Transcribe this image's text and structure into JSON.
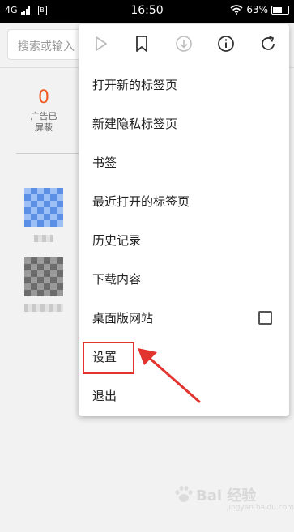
{
  "status_bar": {
    "network": "4G",
    "sim_label": "B",
    "time": "16:50",
    "battery": "63%",
    "battery_level": 0.63
  },
  "search": {
    "placeholder_visible": "搜索或输入"
  },
  "stats": {
    "blocked_count": "0",
    "blocked_label": "广告已屏蔽"
  },
  "menu": {
    "toolbar_icons": [
      "forward-icon",
      "bookmark-add-icon",
      "download-icon",
      "info-icon",
      "refresh-icon"
    ],
    "items": [
      {
        "label": "打开新的标签页"
      },
      {
        "label": "新建隐私标签页"
      },
      {
        "label": "书签"
      },
      {
        "label": "最近打开的标签页"
      },
      {
        "label": "历史记录"
      },
      {
        "label": "下载内容"
      },
      {
        "label": "桌面版网站",
        "checkbox": false
      },
      {
        "label": "设置"
      },
      {
        "label": "退出"
      }
    ]
  },
  "annotation": {
    "highlight_color": "#e2332f"
  },
  "watermark": {
    "text": "Bai 经验",
    "sub": "jingyan.baidu.com"
  },
  "colors": {
    "accent_orange": "#f05a23",
    "disabled_icon": "#bdbdbd",
    "active_icon": "#333333"
  }
}
